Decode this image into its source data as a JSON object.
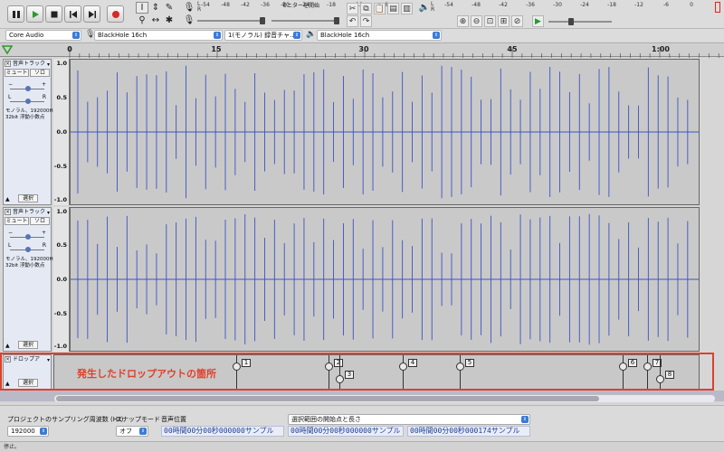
{
  "toolbar": {
    "meter_scale": [
      "-54",
      "-48",
      "-42",
      "-36",
      "-30",
      "-24",
      "-18",
      "-12",
      "-6"
    ],
    "monitor_label": "モニターを開始",
    "meter_scale2": [
      "-54",
      "-48",
      "-42",
      "-36",
      "-30",
      "-24",
      "-18",
      "-12",
      "-6",
      "0"
    ],
    "channel_l": "L",
    "channel_r": "R"
  },
  "devicebar": {
    "host": "Core Audio",
    "input_device": "BlackHole 16ch",
    "channels": "1(モノラル) 録音チャ...",
    "output_device": "BlackHole 16ch"
  },
  "timeline": {
    "ticks": [
      "0",
      "15",
      "30",
      "45",
      "1:00"
    ]
  },
  "tracks": [
    {
      "name": "音声トラック",
      "mute": "ミュート",
      "solo": "ソロ",
      "gain_minus": "−",
      "gain_plus": "+",
      "pan_l": "L",
      "pan_r": "R",
      "info_line1": "モノラル、192000Hz",
      "info_line2": "32bit 浮動小数点",
      "select": "選択",
      "scale": [
        "1.0",
        "0.5",
        "0.0",
        "-0.5",
        "-1.0"
      ]
    },
    {
      "name": "音声トラック",
      "mute": "ミュート",
      "solo": "ソロ",
      "gain_minus": "−",
      "gain_plus": "+",
      "pan_l": "L",
      "pan_r": "R",
      "info_line1": "モノラル、192000Hz",
      "info_line2": "32bit 浮動小数点",
      "select": "選択",
      "scale": [
        "1.0",
        "0.5",
        "0.0",
        "-0.5",
        "-1.0"
      ]
    }
  ],
  "label_track": {
    "name": "ドロップア",
    "select": "選択",
    "annotation": "発生したドロップアウトの箇所",
    "labels": [
      "1",
      "2",
      "3",
      "4",
      "5",
      "6",
      "7",
      "8"
    ]
  },
  "bottombar": {
    "rate_label": "プロジェクトのサンプリング周波数 (Hz)",
    "rate_value": "192000",
    "snap_label": "スナップモード",
    "snap_value": "オフ",
    "position_label": "音声位置",
    "position_value": "00時間00分00秒000000サンプル",
    "selection_label": "選択範囲の開始点と長さ",
    "selection_start": "00時間00分00秒000000サンプル",
    "selection_length": "00時間00分00秒000174サンプル"
  },
  "status": "停止。",
  "colors": {
    "waveform": "#3d52c4",
    "highlight": "#e0402a",
    "time_text": "#1f3f93",
    "accent_blue": "#3b7bd8"
  }
}
